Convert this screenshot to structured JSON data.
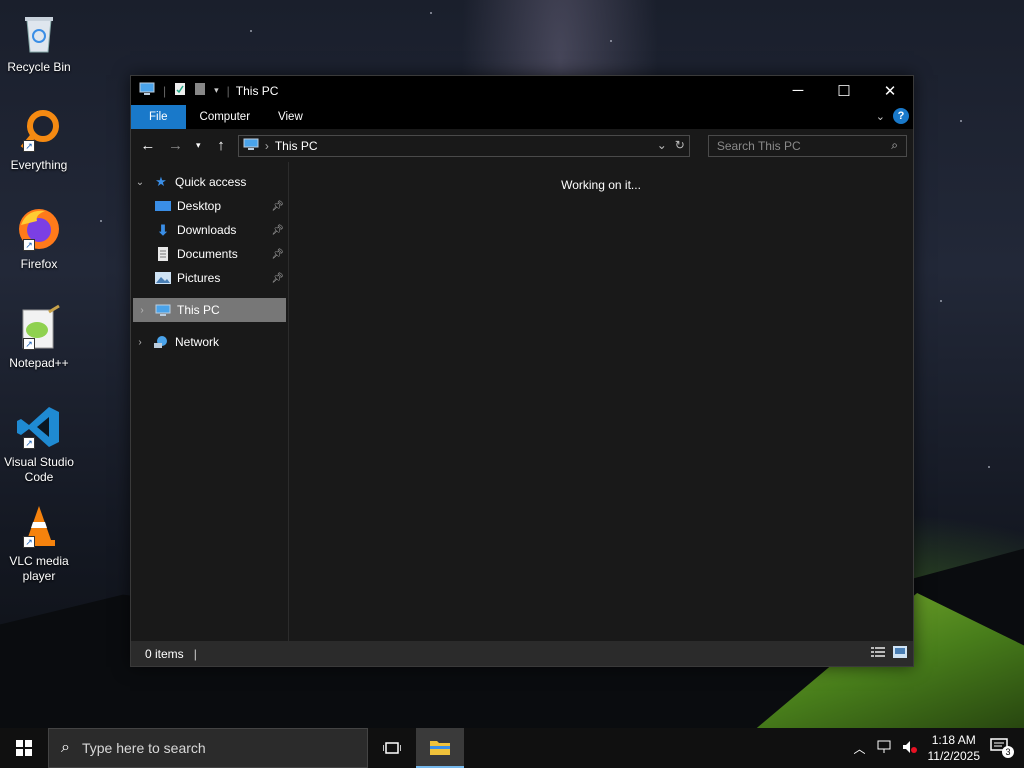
{
  "desktop": {
    "icons": [
      {
        "label": "Recycle Bin"
      },
      {
        "label": "Everything"
      },
      {
        "label": "Firefox"
      },
      {
        "label": "Notepad++"
      },
      {
        "label": "Visual Studio Code"
      },
      {
        "label": "VLC media player"
      }
    ]
  },
  "window": {
    "title": "This PC",
    "ribbon_tabs": [
      "File",
      "Computer",
      "View"
    ],
    "help_label": "?",
    "address": {
      "crumb": "This PC"
    },
    "search": {
      "placeholder": "Search This PC"
    },
    "nav": {
      "quick_access": "Quick access",
      "quick_items": [
        "Desktop",
        "Downloads",
        "Documents",
        "Pictures"
      ],
      "this_pc": "This PC",
      "network": "Network"
    },
    "content": {
      "message": "Working on it..."
    },
    "status": {
      "items": "0 items"
    }
  },
  "taskbar": {
    "search_placeholder": "Type here to search",
    "clock_time": "1:18 AM",
    "clock_date": "11/2/2025",
    "notification_count": "3"
  },
  "colors": {
    "accent": "#1979ca",
    "selected": "#777777",
    "window_bg": "#191919"
  }
}
